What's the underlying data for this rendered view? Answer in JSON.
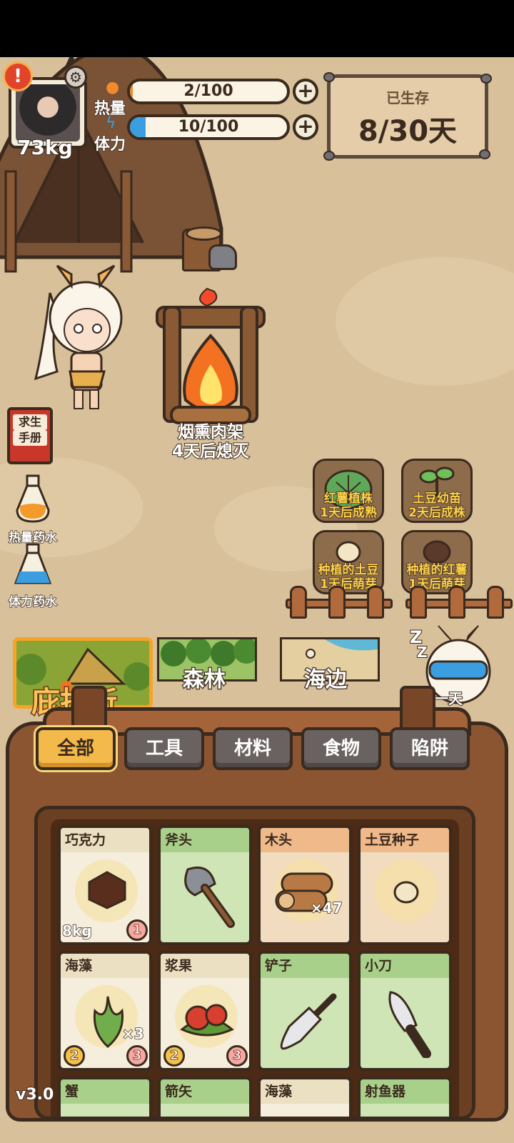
{
  "hud": {
    "weight": "73kg",
    "calorie_label": "热量",
    "calorie_value": "2/100",
    "calorie_progress": 0.02,
    "stamina_label": "体力",
    "stamina_value": "10/100",
    "stamina_progress": 0.1,
    "plus_symbol": "+",
    "alert_symbol": "!",
    "survival_title": "已生存",
    "survival_value": "8/30天"
  },
  "scene": {
    "campfire_name": "烟熏肉架",
    "campfire_status": "4天后熄灭"
  },
  "side_tools": {
    "book_line1": "求生",
    "book_line2": "手册",
    "calorie_potion": "热量药水",
    "stamina_potion": "体力药水"
  },
  "garden": [
    {
      "name": "红薯植株",
      "status": "1天后成熟"
    },
    {
      "name": "土豆幼苗",
      "status": "2天后成株"
    },
    {
      "name": "种植的土豆",
      "status": "1天后萌芽"
    },
    {
      "name": "种植的红薯",
      "status": "1天后萌芽"
    }
  ],
  "locations": {
    "shelter": "庇护所",
    "forest": "森林",
    "beach": "海边",
    "next_day": "下一天",
    "sleep_z": "Z"
  },
  "tabs": [
    "全部",
    "工具",
    "材料",
    "食物",
    "陷阱"
  ],
  "items": [
    {
      "name": "巧克力",
      "kind": "food",
      "weight": "8kg",
      "badge": "1"
    },
    {
      "name": "斧头",
      "kind": "tool"
    },
    {
      "name": "木头",
      "kind": "mat",
      "count": "×47"
    },
    {
      "name": "土豆种子",
      "kind": "mat"
    },
    {
      "name": "海藻",
      "kind": "food",
      "count": "×3",
      "left_badge": "2",
      "badge": "3"
    },
    {
      "name": "浆果",
      "kind": "food",
      "left_badge": "2",
      "badge": "3"
    },
    {
      "name": "铲子",
      "kind": "tool"
    },
    {
      "name": "小刀",
      "kind": "tool"
    },
    {
      "name": "蟹",
      "kind": "tool"
    },
    {
      "name": "箭矢",
      "kind": "tool"
    },
    {
      "name": "海藻",
      "kind": "food"
    },
    {
      "name": "射鱼器",
      "kind": "tool"
    }
  ],
  "version": "v3.0",
  "colors": {
    "ground": "#d7c09a",
    "outline": "#3b2a1e",
    "active_tab": "#f3b94a",
    "stamina_bar": "#3a9ee0",
    "bag": "#8b5532"
  }
}
